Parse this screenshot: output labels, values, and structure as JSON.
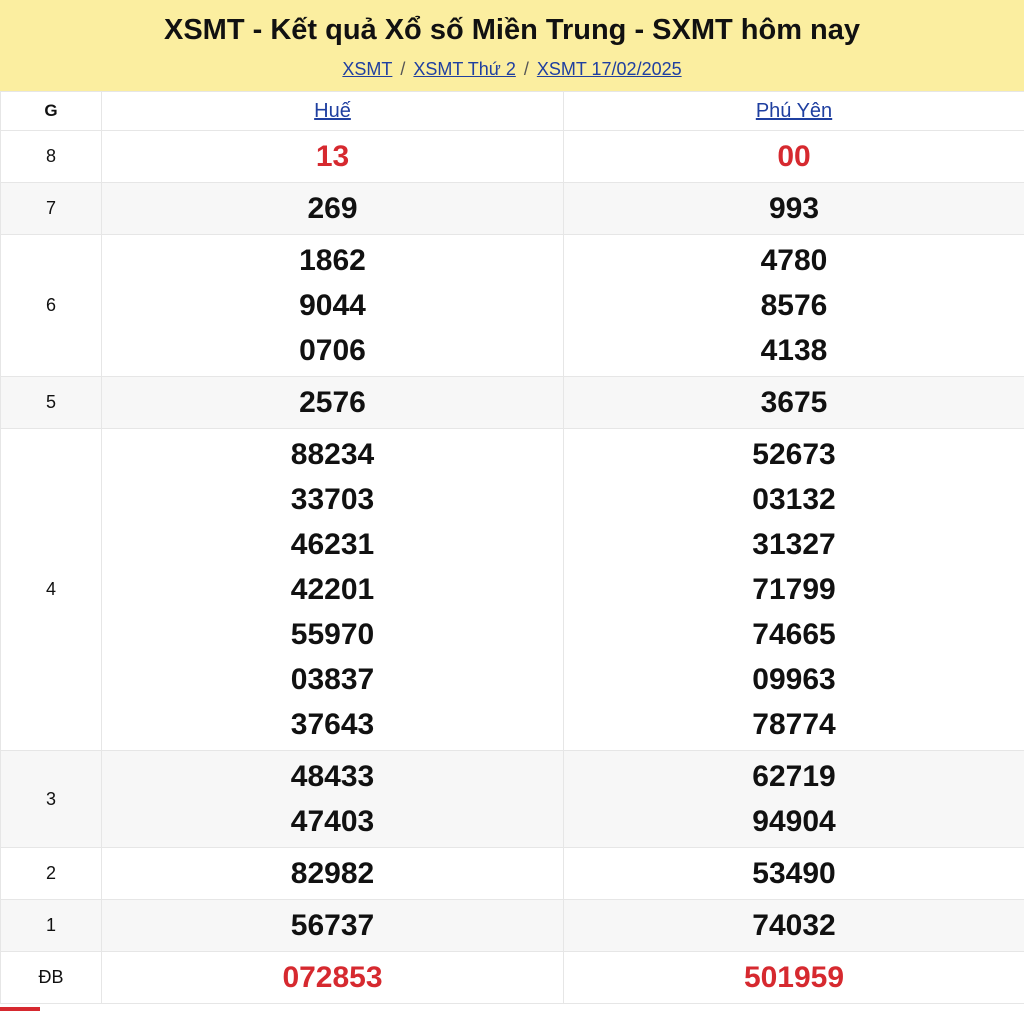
{
  "header": {
    "title": "XSMT - Kết quả Xổ số Miền Trung - SXMT hôm nay",
    "breadcrumbs": [
      "XSMT",
      "XSMT Thứ 2",
      "XSMT 17/02/2025"
    ],
    "separator": "/"
  },
  "table": {
    "col_header": "G",
    "stations": [
      "Huế",
      "Phú Yên"
    ],
    "rows": [
      {
        "label": "8",
        "hue": [
          "13"
        ],
        "phuyen": [
          "00"
        ],
        "red": true
      },
      {
        "label": "7",
        "hue": [
          "269"
        ],
        "phuyen": [
          "993"
        ]
      },
      {
        "label": "6",
        "hue": [
          "1862",
          "9044",
          "0706"
        ],
        "phuyen": [
          "4780",
          "8576",
          "4138"
        ]
      },
      {
        "label": "5",
        "hue": [
          "2576"
        ],
        "phuyen": [
          "3675"
        ]
      },
      {
        "label": "4",
        "hue": [
          "88234",
          "33703",
          "46231",
          "42201",
          "55970",
          "03837",
          "37643"
        ],
        "phuyen": [
          "52673",
          "03132",
          "31327",
          "71799",
          "74665",
          "09963",
          "78774"
        ]
      },
      {
        "label": "3",
        "hue": [
          "48433",
          "47403"
        ],
        "phuyen": [
          "62719",
          "94904"
        ]
      },
      {
        "label": "2",
        "hue": [
          "82982"
        ],
        "phuyen": [
          "53490"
        ]
      },
      {
        "label": "1",
        "hue": [
          "56737"
        ],
        "phuyen": [
          "74032"
        ]
      },
      {
        "label": "ĐB",
        "hue": [
          "072853"
        ],
        "phuyen": [
          "501959"
        ],
        "red": true
      }
    ]
  },
  "colors": {
    "header_bg": "#fbeea0",
    "link": "#1f3fa0",
    "prize_red": "#d6292f",
    "alt_row": "#f7f7f7"
  }
}
